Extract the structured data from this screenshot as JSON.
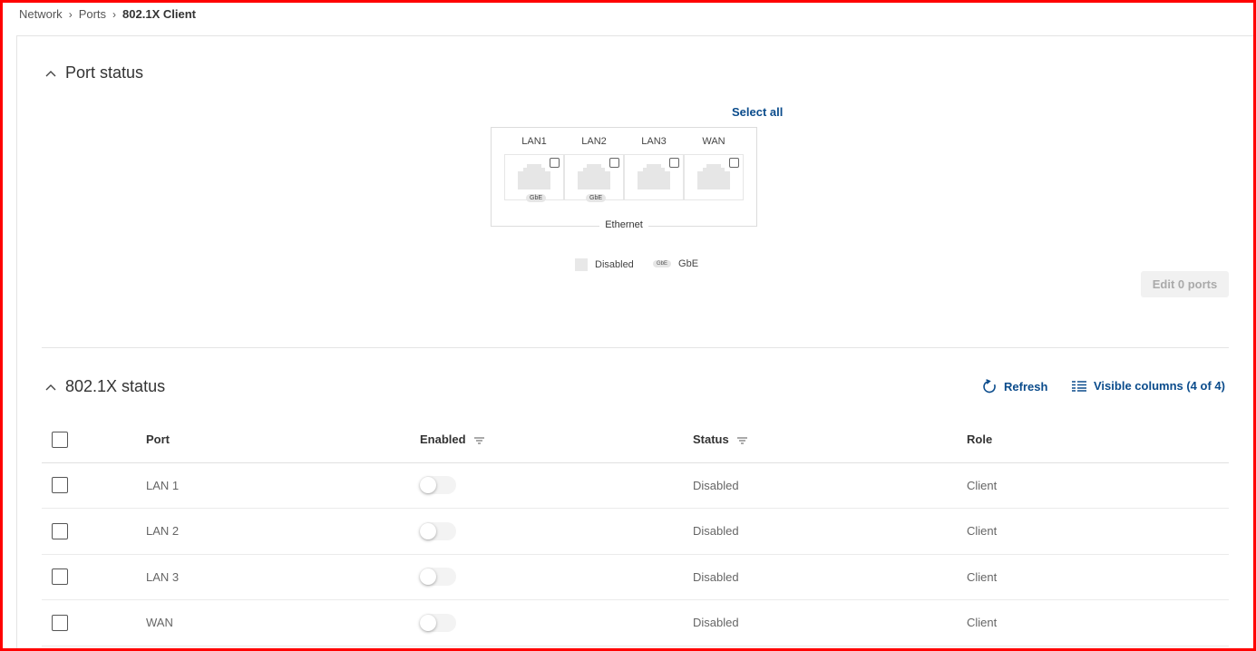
{
  "breadcrumb": {
    "items": [
      "Network",
      "Ports"
    ],
    "current": "802.1X Client"
  },
  "port_status": {
    "title": "Port status",
    "select_all": "Select all",
    "ports": [
      {
        "label": "LAN1",
        "speed": "GbE"
      },
      {
        "label": "LAN2",
        "speed": "GbE"
      },
      {
        "label": "LAN3",
        "speed": ""
      },
      {
        "label": "WAN",
        "speed": ""
      }
    ],
    "group_label": "Ethernet",
    "legend": {
      "disabled": "Disabled",
      "gbe_badge": "GbE",
      "gbe": "GbE"
    },
    "edit_button": "Edit 0 ports"
  },
  "dot1x_status": {
    "title": "802.1X status",
    "refresh": "Refresh",
    "visible_columns": "Visible columns (4 of 4)",
    "columns": {
      "port": "Port",
      "enabled": "Enabled",
      "status": "Status",
      "role": "Role"
    },
    "rows": [
      {
        "port": "LAN 1",
        "enabled": false,
        "status": "Disabled",
        "role": "Client"
      },
      {
        "port": "LAN 2",
        "enabled": false,
        "status": "Disabled",
        "role": "Client"
      },
      {
        "port": "LAN 3",
        "enabled": false,
        "status": "Disabled",
        "role": "Client"
      },
      {
        "port": "WAN",
        "enabled": false,
        "status": "Disabled",
        "role": "Client"
      }
    ]
  },
  "colors": {
    "accent": "#0b4c8c",
    "frame": "#ff0000"
  },
  "icons": {
    "collapse": "chevron-up-icon",
    "refresh": "refresh-icon",
    "columns": "columns-icon",
    "filter": "filter-icon",
    "port": "ethernet-port-icon"
  }
}
